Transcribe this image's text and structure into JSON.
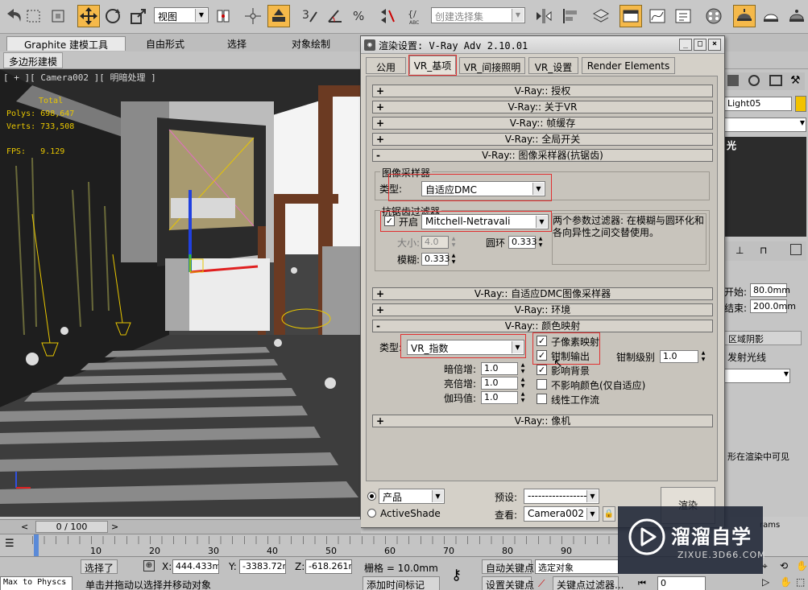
{
  "toolbar": {
    "view_combo": "视图",
    "selection_set_placeholder": "创建选择集",
    "icons": [
      "select-move-icon",
      "rotate-icon",
      "scale-icon",
      "snap-icon",
      "angle-snap-icon",
      "percent-snap-icon",
      "spinner-snap-icon",
      "edit-named-selection-icon",
      "mirror-icon",
      "align-icon",
      "layer-icon",
      "curve-editor-icon",
      "schematic-icon",
      "material-editor-icon",
      "render-setup-icon",
      "rendered-frame-icon",
      "render-icon"
    ]
  },
  "ribbon": {
    "tabs": [
      "Graphite 建模工具",
      "自由形式",
      "选择",
      "对象绘制"
    ],
    "subtab": "多边形建模"
  },
  "viewport": {
    "label": "[ + ][ Camera002 ][ 明暗处理 ]",
    "stats_header": "Total",
    "polys_label": "Polys:",
    "polys_value": "698,647",
    "verts_label": "Verts:",
    "verts_value": "733,508",
    "fps_label": "FPS:",
    "fps_value": "9.129"
  },
  "dialog": {
    "title": "渲染设置: V-Ray Adv 2.10.01",
    "tabs": [
      "公用",
      "VR_基项",
      "VR_间接照明",
      "VR_设置",
      "Render Elements"
    ],
    "active_tab": "VR_基项",
    "rollouts_top": [
      {
        "sign": "+",
        "label": "V-Ray:: 授权"
      },
      {
        "sign": "+",
        "label": "V-Ray:: 关于VR"
      },
      {
        "sign": "+",
        "label": "V-Ray:: 帧缓存"
      },
      {
        "sign": "+",
        "label": "V-Ray:: 全局开关"
      },
      {
        "sign": "-",
        "label": "V-Ray:: 图像采样器(抗锯齿)"
      }
    ],
    "image_sampler": {
      "group_title": "图像采样器",
      "type_label": "类型:",
      "type_value": "自适应DMC"
    },
    "aa_filter": {
      "group_title": "抗锯齿过滤器",
      "enable_label": "开启",
      "enabled": true,
      "filter_value": "Mitchell-Netravali",
      "description": "两个参数过滤器: 在模糊与圆环化和各向异性之间交替使用。",
      "size_label": "大小:",
      "size_value": "4.0",
      "ringing_label": "圆环",
      "ringing_value": "0.333",
      "blur_label": "模糊:",
      "blur_value": "0.333"
    },
    "rollouts_mid": [
      {
        "sign": "+",
        "label": "V-Ray:: 自适应DMC图像采样器"
      },
      {
        "sign": "+",
        "label": "V-Ray:: 环境"
      },
      {
        "sign": "-",
        "label": "V-Ray:: 颜色映射"
      }
    ],
    "color_mapping": {
      "type_label": "类型:",
      "type_value": "VR_指数",
      "dark_label": "暗倍增:",
      "dark_value": "1.0",
      "bright_label": "亮倍增:",
      "bright_value": "1.0",
      "gamma_label": "伽玛值:",
      "gamma_value": "1.0",
      "checks": [
        {
          "label": "子像素映射",
          "checked": true
        },
        {
          "label": "钳制输出",
          "checked": true
        },
        {
          "label": "影响背景",
          "checked": true
        },
        {
          "label": "不影响颜色(仅自适应)",
          "checked": false
        },
        {
          "label": "线性工作流",
          "checked": false
        }
      ],
      "clamp_level_label": "钳制级别",
      "clamp_level_value": "1.0"
    },
    "rollouts_bottom": [
      {
        "sign": "+",
        "label": "V-Ray:: 像机"
      }
    ],
    "footer": {
      "product_value": "产品",
      "activeshade_label": "ActiveShade",
      "preset_label": "预设:",
      "preset_value": "--------------------",
      "view_label": "查看:",
      "view_value": "Camera002",
      "render_button": "渲染"
    }
  },
  "cmdpanel": {
    "name_field": "Light05",
    "light_label": "光",
    "start_label": "开始:",
    "start_value": "80.0mm",
    "end_label": "结束:",
    "end_value": "200.0mm",
    "area_shadow": "区域阴影",
    "emit_light": "发射光线",
    "visible_note": "形在渲染中可见",
    "rams": "rams"
  },
  "timeline": {
    "frame_display": "0 / 100",
    "ticks": [
      "10",
      "20",
      "30",
      "40",
      "50",
      "60",
      "70",
      "80",
      "90"
    ]
  },
  "status": {
    "maxscript": "Max to Physcs (",
    "selected_label": "选择了",
    "x_label": "X:",
    "x_value": "444.433mm",
    "y_label": "Y:",
    "y_value": "-3383.72mm",
    "z_label": "Z:",
    "z_value": "-618.261mm",
    "grid_label": "栅格 = 10.0mm",
    "hint": "单击并拖动以选择并移动对象",
    "auto_key": "自动关键点",
    "set_key": "设置关键点",
    "selected_objects": "选定对象",
    "key_filters": "关键点过滤器...",
    "add_time_tag": "添加时间标记",
    "frame_value": "0"
  },
  "watermark": {
    "brand": "溜溜自学",
    "url": "ZIXUE.3D66.COM"
  },
  "colors": {
    "highlight": "#e03030",
    "active_button": "#f5b94a",
    "stats_text": "#e8c600"
  }
}
